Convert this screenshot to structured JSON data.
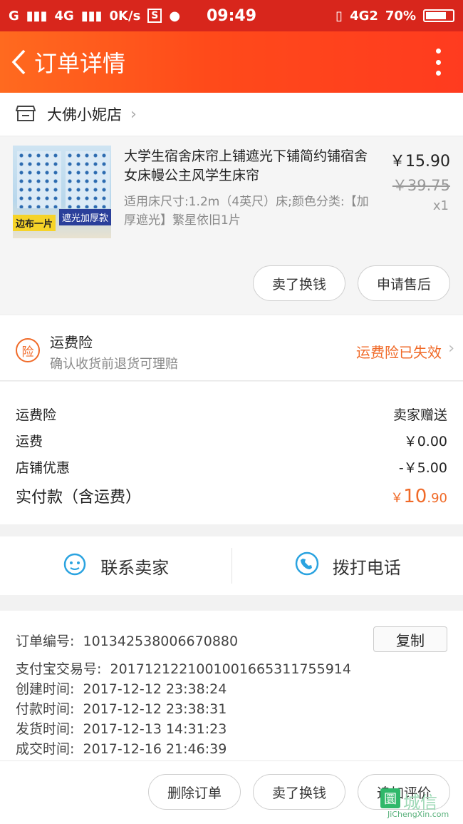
{
  "status_bar": {
    "carrier1": "G",
    "carrier2": "4G",
    "speed": "0K/s",
    "sim_badge": "S",
    "time": "09:49",
    "net": "4G2",
    "battery": "70%"
  },
  "header": {
    "title": "订单详情"
  },
  "store": {
    "name": "大佛小妮店"
  },
  "product": {
    "title": "大学生宿舍床帘上铺遮光下铺简约铺宿舍女床幔公主风学生床帘",
    "spec": "适用床尺寸:1.2m（4英尺）床;颜色分类:【加厚遮光】繁星依旧1片",
    "price": "￥15.90",
    "original_price": "￥39.75",
    "quantity": "x1",
    "thumb_tag1": "边布一片",
    "thumb_tag2": "遮光加厚款",
    "btn_resell": "卖了换钱",
    "btn_after_sale": "申请售后"
  },
  "insurance": {
    "icon_label": "险",
    "title": "运费险",
    "subtitle": "确认收货前退货可理赔",
    "status": "运费险已失效"
  },
  "fees": {
    "rows": [
      {
        "label": "运费险",
        "value": "卖家赠送"
      },
      {
        "label": "运费",
        "value": "￥0.00"
      },
      {
        "label": "店铺优惠",
        "value": "-￥5.00"
      }
    ],
    "total_label": "实付款（含运费）",
    "total_symbol": "￥",
    "total_int": "10",
    "total_dec": ".90"
  },
  "contact": {
    "seller": "联系卖家",
    "call": "拨打电话"
  },
  "order_info": {
    "order_no_label": "订单编号:",
    "order_no": "101342538006670880",
    "copy": "复制",
    "alipay_label": "支付宝交易号:",
    "alipay_no": "2017121221001001665311755914",
    "created_label": "创建时间:",
    "created": "2017-12-12 23:38:24",
    "paid_label": "付款时间:",
    "paid": "2017-12-12 23:38:31",
    "shipped_label": "发货时间:",
    "shipped": "2017-12-13 14:31:23",
    "closed_label": "成交时间:",
    "closed": "2017-12-16 21:46:39"
  },
  "bottom_actions": {
    "delete": "删除订单",
    "resell": "卖了换钱",
    "review": "追加评价"
  },
  "watermark": {
    "logo": "圜",
    "text": "城信",
    "url": "JiChengXin.com"
  },
  "colors": {
    "accent": "#f06a28",
    "header": "#ff4a1a",
    "statusbar": "#d8261c"
  }
}
